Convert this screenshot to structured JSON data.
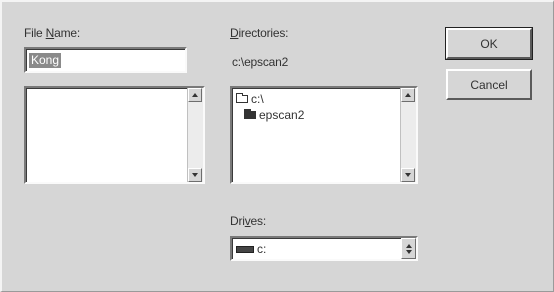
{
  "file_name": {
    "label_prefix": "File ",
    "label_accel": "N",
    "label_suffix": "ame:",
    "value": "Kong"
  },
  "directories": {
    "label_accel": "D",
    "label_suffix": "irectories:",
    "current_path": "c:\\epscan2",
    "tree": [
      {
        "label": "c:\\",
        "icon": "open-folder-icon"
      },
      {
        "label": "epscan2",
        "icon": "closed-folder-icon"
      }
    ]
  },
  "drives": {
    "label_prefix": "Dri",
    "label_accel": "v",
    "label_suffix": "es:",
    "selected": "c:",
    "icon": "hard-drive-icon"
  },
  "buttons": {
    "ok": "OK",
    "cancel": "Cancel"
  }
}
